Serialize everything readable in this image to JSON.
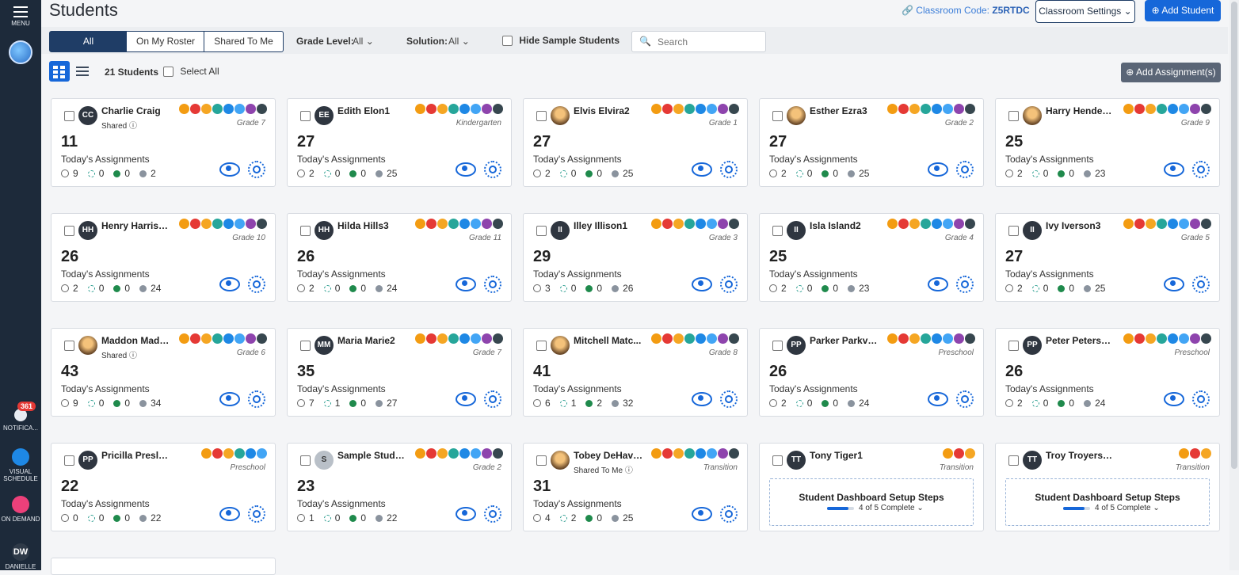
{
  "sidebar": {
    "menu_label": "MENU",
    "notifications_label": "NOTIFICA...",
    "notifications_badge": "361",
    "visual_schedule_label": "VISUAL SCHEDULE",
    "on_demand_label": "ON DEMAND",
    "user_initials": "DW",
    "user_label": "DANIELLE"
  },
  "header": {
    "title": "Students",
    "classroom_code_label": "Classroom Code:",
    "classroom_code": "Z5RTDC",
    "settings_label": "Classroom Settings",
    "add_student_label": "Add Student"
  },
  "filters": {
    "tabs": [
      "All",
      "On My Roster",
      "Shared To Me"
    ],
    "grade_label": "Grade Level:",
    "grade_value": "All",
    "solution_label": "Solution:",
    "solution_value": "All",
    "hide_sample_label": "Hide Sample Students",
    "search_placeholder": "Search"
  },
  "toolbar": {
    "count_label": "21 Students",
    "select_all_label": "Select All",
    "add_assignments_label": "Add Assignment(s)"
  },
  "card_label": "Today's Assignments",
  "students": [
    {
      "name": "Charlie Craig",
      "initials": "CC",
      "sub": "Shared",
      "grade": "Grade 7",
      "count": "11",
      "stats": [
        "9",
        "0",
        "0",
        "2"
      ]
    },
    {
      "name": "Edith Elon1",
      "initials": "EE",
      "sub": "",
      "grade": "Kindergarten",
      "count": "27",
      "stats": [
        "2",
        "0",
        "0",
        "25"
      ]
    },
    {
      "name": "Elvis Elvira2",
      "initials": "",
      "sub": "",
      "grade": "Grade 1",
      "count": "27",
      "stats": [
        "2",
        "0",
        "0",
        "25"
      ]
    },
    {
      "name": "Esther Ezra3",
      "initials": "",
      "sub": "",
      "grade": "Grade 2",
      "count": "27",
      "stats": [
        "2",
        "0",
        "0",
        "25"
      ]
    },
    {
      "name": "Harry Henders...",
      "initials": "",
      "sub": "",
      "grade": "Grade 9",
      "count": "25",
      "stats": [
        "2",
        "0",
        "0",
        "23"
      ]
    },
    {
      "name": "Henry Harriso...",
      "initials": "HH",
      "sub": "",
      "grade": "Grade 10",
      "count": "26",
      "stats": [
        "2",
        "0",
        "0",
        "24"
      ]
    },
    {
      "name": "Hilda Hills3",
      "initials": "HH",
      "sub": "",
      "grade": "Grade 11",
      "count": "26",
      "stats": [
        "2",
        "0",
        "0",
        "24"
      ]
    },
    {
      "name": "Illey Illison1",
      "initials": "II",
      "sub": "",
      "grade": "Grade 3",
      "count": "29",
      "stats": [
        "3",
        "0",
        "0",
        "26"
      ]
    },
    {
      "name": "Isla Island2",
      "initials": "II",
      "sub": "",
      "grade": "Grade 4",
      "count": "25",
      "stats": [
        "2",
        "0",
        "0",
        "23"
      ]
    },
    {
      "name": "Ivy Iverson3",
      "initials": "II",
      "sub": "",
      "grade": "Grade 5",
      "count": "27",
      "stats": [
        "2",
        "0",
        "0",
        "25"
      ]
    },
    {
      "name": "Maddon Madd...",
      "initials": "",
      "sub": "Shared",
      "grade": "Grade 6",
      "count": "43",
      "stats": [
        "9",
        "0",
        "0",
        "34"
      ]
    },
    {
      "name": "Maria Marie2",
      "initials": "MM",
      "sub": "",
      "grade": "Grade 7",
      "count": "35",
      "stats": [
        "7",
        "1",
        "0",
        "27"
      ]
    },
    {
      "name": "Mitchell Matc...",
      "initials": "",
      "sub": "",
      "grade": "Grade 8",
      "count": "41",
      "stats": [
        "6",
        "1",
        "2",
        "32"
      ]
    },
    {
      "name": "Parker Parkvie...",
      "initials": "PP",
      "sub": "",
      "grade": "Preschool",
      "count": "26",
      "stats": [
        "2",
        "0",
        "0",
        "24"
      ]
    },
    {
      "name": "Peter Peterson2",
      "initials": "PP",
      "sub": "",
      "grade": "Preschool",
      "count": "26",
      "stats": [
        "2",
        "0",
        "0",
        "24"
      ]
    },
    {
      "name": "Pricilla Presley3",
      "initials": "PP",
      "sub": "",
      "grade": "Preschool",
      "count": "22",
      "stats": [
        "0",
        "0",
        "0",
        "22"
      ]
    },
    {
      "name": "Sample Stude...",
      "initials": "S",
      "sub": "",
      "grade": "Grade 2",
      "count": "23",
      "stats": [
        "1",
        "0",
        "0",
        "22"
      ]
    },
    {
      "name": "Tobey DeHaven",
      "initials": "",
      "sub": "Shared To Me",
      "grade": "Transition",
      "count": "31",
      "stats": [
        "4",
        "2",
        "0",
        "25"
      ]
    },
    {
      "name": "Tony Tiger1",
      "initials": "TT",
      "sub": "",
      "grade": "Transition",
      "setup": true
    },
    {
      "name": "Troy Troyerson2",
      "initials": "TT",
      "sub": "",
      "grade": "Transition",
      "setup": true
    }
  ],
  "setup": {
    "title": "Student Dashboard Setup Steps",
    "progress_text": "4 of 5 Complete",
    "progress_fraction": 0.8
  },
  "colors": {
    "primary": "#1667d9",
    "navy": "#1f3d66",
    "sidebar": "#1d2a3a"
  }
}
